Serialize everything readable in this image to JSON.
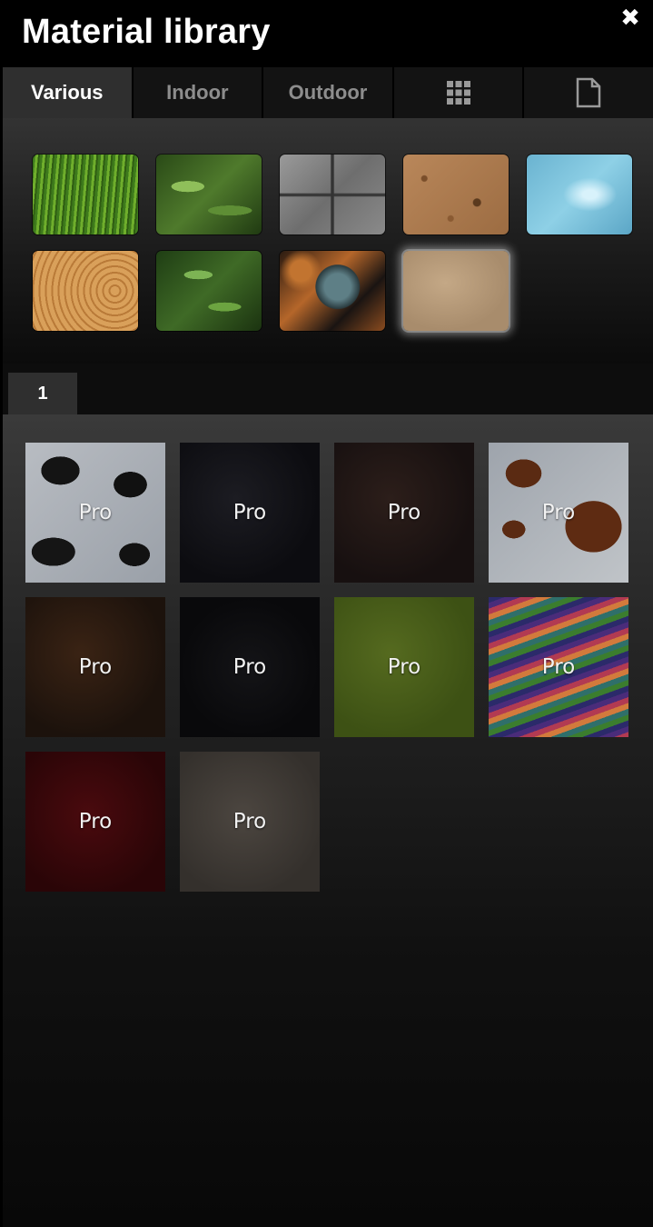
{
  "header": {
    "title": "Material library",
    "close_icon": "close-icon"
  },
  "tabs": [
    {
      "label": "Various",
      "active": true
    },
    {
      "label": "Indoor",
      "active": false
    },
    {
      "label": "Outdoor",
      "active": false
    },
    {
      "label": "",
      "icon": "grid-icon",
      "active": false
    },
    {
      "label": "",
      "icon": "document-icon",
      "active": false
    }
  ],
  "textures": [
    {
      "name": "grass"
    },
    {
      "name": "leaves"
    },
    {
      "name": "stone"
    },
    {
      "name": "soil"
    },
    {
      "name": "water"
    },
    {
      "name": "wood"
    },
    {
      "name": "leaves-2"
    },
    {
      "name": "metal"
    },
    {
      "name": "suede",
      "selected": true
    }
  ],
  "pagination": {
    "current_page": "1"
  },
  "pro_materials": {
    "badge": "Pro",
    "items": [
      {
        "name": "cow-white-black",
        "badge": "Pro"
      },
      {
        "name": "black",
        "badge": "Pro"
      },
      {
        "name": "dark-brown",
        "badge": "Pro"
      },
      {
        "name": "cow-brown-white",
        "badge": "Pro"
      },
      {
        "name": "brown",
        "badge": "Pro"
      },
      {
        "name": "black-2",
        "badge": "Pro"
      },
      {
        "name": "olive-green",
        "badge": "Pro"
      },
      {
        "name": "rainbow-stripes",
        "badge": "Pro"
      },
      {
        "name": "dark-red",
        "badge": "Pro"
      },
      {
        "name": "grey-brown",
        "badge": "Pro"
      }
    ]
  },
  "colors": {
    "background": "#000000",
    "active_tab": "#2f2f2f",
    "inactive_tab_text": "#8d8d8d",
    "text": "#ffffff"
  }
}
